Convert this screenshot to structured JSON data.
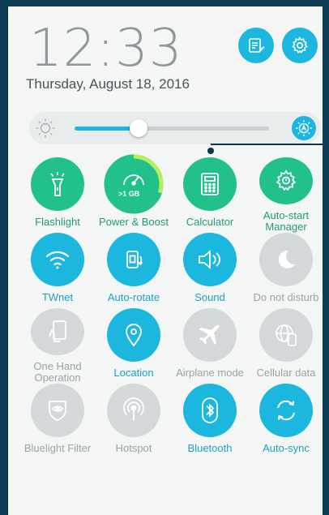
{
  "lock": {
    "time": "12:33",
    "date": "Thursday, August 18, 2016"
  },
  "brightness": {
    "level_percent": 33
  },
  "boost": {
    "memory_label": ">1 GB",
    "ring_fraction": 0.3
  },
  "tiles": [
    {
      "id": "flashlight",
      "label": "Flashlight",
      "state": "on",
      "color": "#22c08b",
      "icon": "flashlight-icon"
    },
    {
      "id": "power-boost",
      "label": "Power & Boost",
      "state": "on",
      "color": "#22c08b",
      "icon": "speedometer-icon"
    },
    {
      "id": "calculator",
      "label": "Calculator",
      "state": "on",
      "color": "#22c08b",
      "icon": "calculator-icon"
    },
    {
      "id": "autostart",
      "label": "Auto-start Manager",
      "state": "on",
      "color": "#22c08b",
      "icon": "gear-icon"
    },
    {
      "id": "twnet",
      "label": "TWnet",
      "state": "on",
      "color": "#1cb7de",
      "icon": "wifi-icon"
    },
    {
      "id": "autorotate",
      "label": "Auto-rotate",
      "state": "on",
      "color": "#1cb7de",
      "icon": "rotate-icon"
    },
    {
      "id": "sound",
      "label": "Sound",
      "state": "on",
      "color": "#1cb7de",
      "icon": "speaker-icon"
    },
    {
      "id": "dnd",
      "label": "Do not disturb",
      "state": "off",
      "color": "#d4d8da",
      "icon": "moon-icon"
    },
    {
      "id": "onehand",
      "label": "One Hand Operation",
      "state": "off",
      "color": "#d4d8da",
      "icon": "one-hand-icon"
    },
    {
      "id": "location",
      "label": "Location",
      "state": "on",
      "color": "#1cb7de",
      "icon": "location-pin-icon"
    },
    {
      "id": "airplane",
      "label": "Airplane mode",
      "state": "off",
      "color": "#d4d8da",
      "icon": "airplane-icon"
    },
    {
      "id": "cellular",
      "label": "Cellular data",
      "state": "off",
      "color": "#d4d8da",
      "icon": "globe-phone-icon"
    },
    {
      "id": "bluelight",
      "label": "Bluelight Filter",
      "state": "off",
      "color": "#d4d8da",
      "icon": "eye-icon"
    },
    {
      "id": "hotspot",
      "label": "Hotspot",
      "state": "off",
      "color": "#d4d8da",
      "icon": "hotspot-icon"
    },
    {
      "id": "bluetooth",
      "label": "Bluetooth",
      "state": "on",
      "color": "#1cb7de",
      "icon": "bluetooth-icon"
    },
    {
      "id": "autosync",
      "label": "Auto-sync",
      "state": "on",
      "color": "#1cb7de",
      "icon": "sync-icon"
    }
  ]
}
